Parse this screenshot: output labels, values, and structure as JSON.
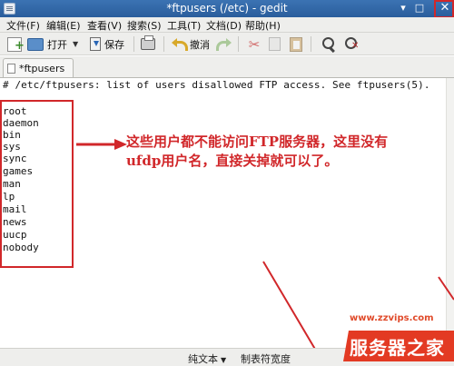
{
  "window": {
    "title": "*ftpusers (/etc) - gedit",
    "min_label": "▾",
    "max_label": "□",
    "close_label": "✕"
  },
  "menu": {
    "items": [
      "文件(F)",
      "编辑(E)",
      "查看(V)",
      "搜索(S)",
      "工具(T)",
      "文档(D)",
      "帮助(H)"
    ]
  },
  "toolbar": {
    "open_label": "打开",
    "save_label": "保存",
    "undo_label": "撤消",
    "dropdown": "▼"
  },
  "tab": {
    "label": "*ftpusers"
  },
  "editor": {
    "header": "# /etc/ftpusers: list of users disallowed FTP access. See ftpusers(5).",
    "users": [
      "root",
      "daemon",
      "bin",
      "sys",
      "sync",
      "games",
      "man",
      "lp",
      "mail",
      "news",
      "uucp",
      "nobody"
    ]
  },
  "annotation": {
    "text": "这些用户都不能访问FTP服务器，这里没有ufdp用户名，直接关掉就可以了。",
    "color": "#d1272a"
  },
  "statusbar": {
    "mode": "纯文本",
    "tab_width": "制表符宽度",
    "arrow": "▼"
  },
  "watermark": {
    "url": "www.zzvips.com",
    "brand": "服务器之家"
  }
}
